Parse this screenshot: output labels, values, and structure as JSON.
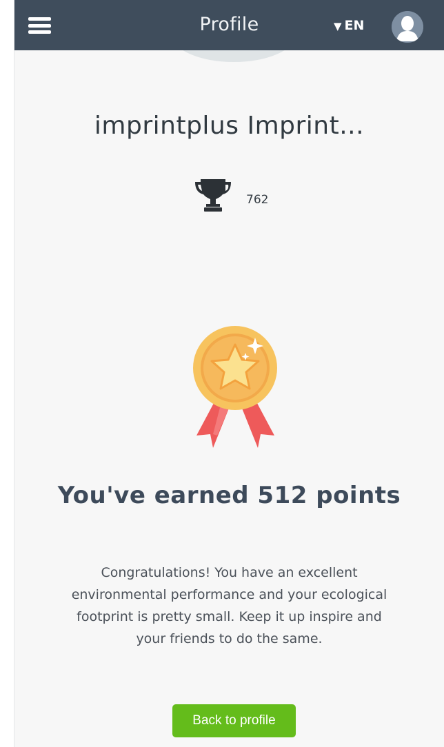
{
  "header": {
    "title": "Profile",
    "language": "EN"
  },
  "profile": {
    "name": "imprintplus Imprint...",
    "score": "762"
  },
  "result": {
    "headline": "You've earned 512 points",
    "message": "Congratulations! You have an excellent environmental performance and your ecological footprint is pretty small. Keep it up inspire and your friends to do the same.",
    "back_label": "Back to profile"
  },
  "icons": {
    "menu": "hamburger-icon",
    "language_caret": "caret-down-icon",
    "avatar": "user-avatar-icon",
    "trophy": "trophy-icon",
    "medal": "medal-icon"
  },
  "colors": {
    "header_bg": "#3f4d5c",
    "page_bg": "#f7f7f7",
    "button_bg": "#64bc1b",
    "medal_gold": "#f7c35e",
    "ribbon": "#ee5a5a"
  }
}
